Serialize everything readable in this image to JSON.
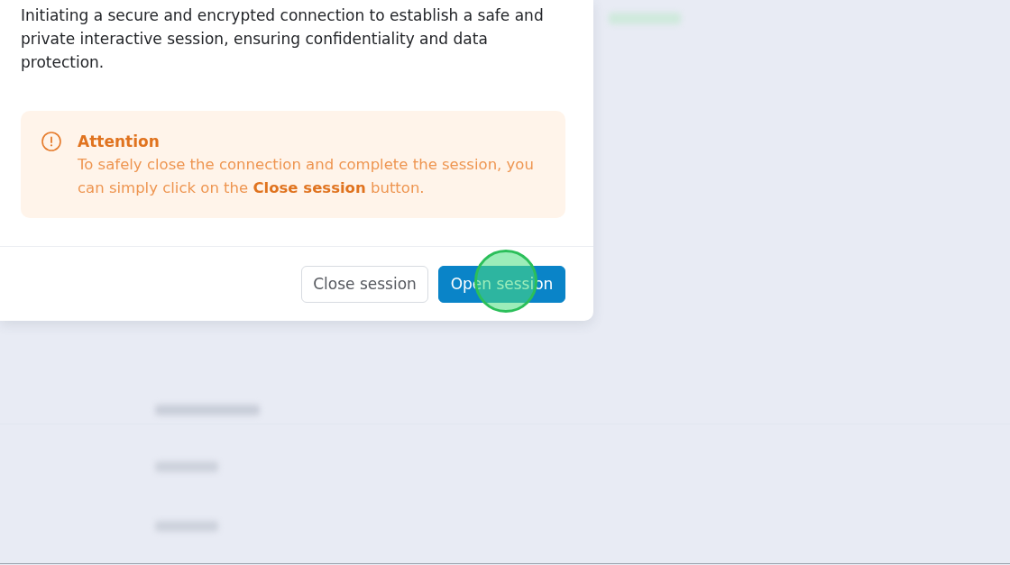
{
  "dialog": {
    "description": "Initiating a secure and encrypted connection to establish a safe and private interactive session, ensuring confidentiality and data protection.",
    "alert": {
      "kind": "warning",
      "title": "Attention",
      "message": "To safely close the connection and complete the session, you can simply click on the **Close session** button."
    },
    "buttons": [
      {
        "label": "Close session",
        "kind": "secondary",
        "click_indicator": false
      },
      {
        "label": "Open session",
        "kind": "primary",
        "click_indicator": true
      }
    ]
  }
}
